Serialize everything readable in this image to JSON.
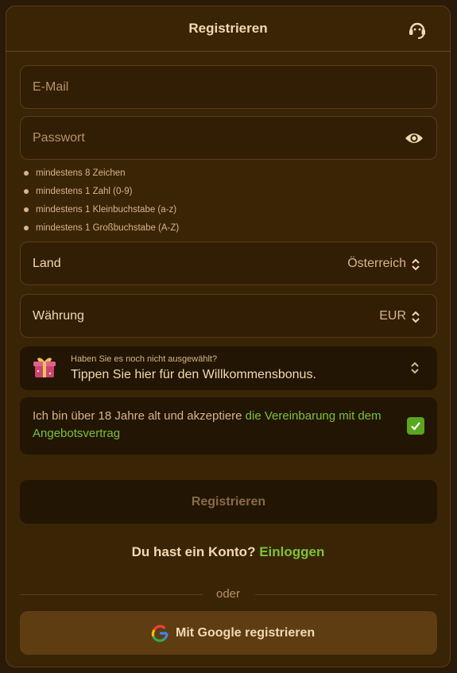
{
  "header": {
    "title": "Registrieren",
    "support_icon": "headset-icon"
  },
  "form": {
    "email_placeholder": "E-Mail",
    "password_placeholder": "Passwort",
    "password_rules": [
      "mindestens 8 Zeichen",
      "mindestens 1 Zahl (0-9)",
      "mindestens 1 Kleinbuchstabe (a-z)",
      "mindestens 1 Großbuchstabe (A-Z)"
    ],
    "country": {
      "label": "Land",
      "value": "Österreich"
    },
    "currency": {
      "label": "Währung",
      "value": "EUR"
    },
    "bonus": {
      "hint": "Haben Sie es noch nicht ausgewählt?",
      "text": "Tippen Sie hier für den Willkommensbonus."
    },
    "agreement": {
      "text": "Ich bin über 18 Jahre alt und akzeptiere ",
      "link": "die Vereinbarung mit dem Angebotsvertrag",
      "checked": true
    },
    "submit_label": "Registrieren"
  },
  "login": {
    "question": "Du hast ein Konto?",
    "link": "Einloggen"
  },
  "divider_text": "oder",
  "google_button": "Mit Google registrieren",
  "colors": {
    "background": "#3a2406",
    "accent_green": "#7cc23a",
    "text": "#f3d9b3"
  }
}
